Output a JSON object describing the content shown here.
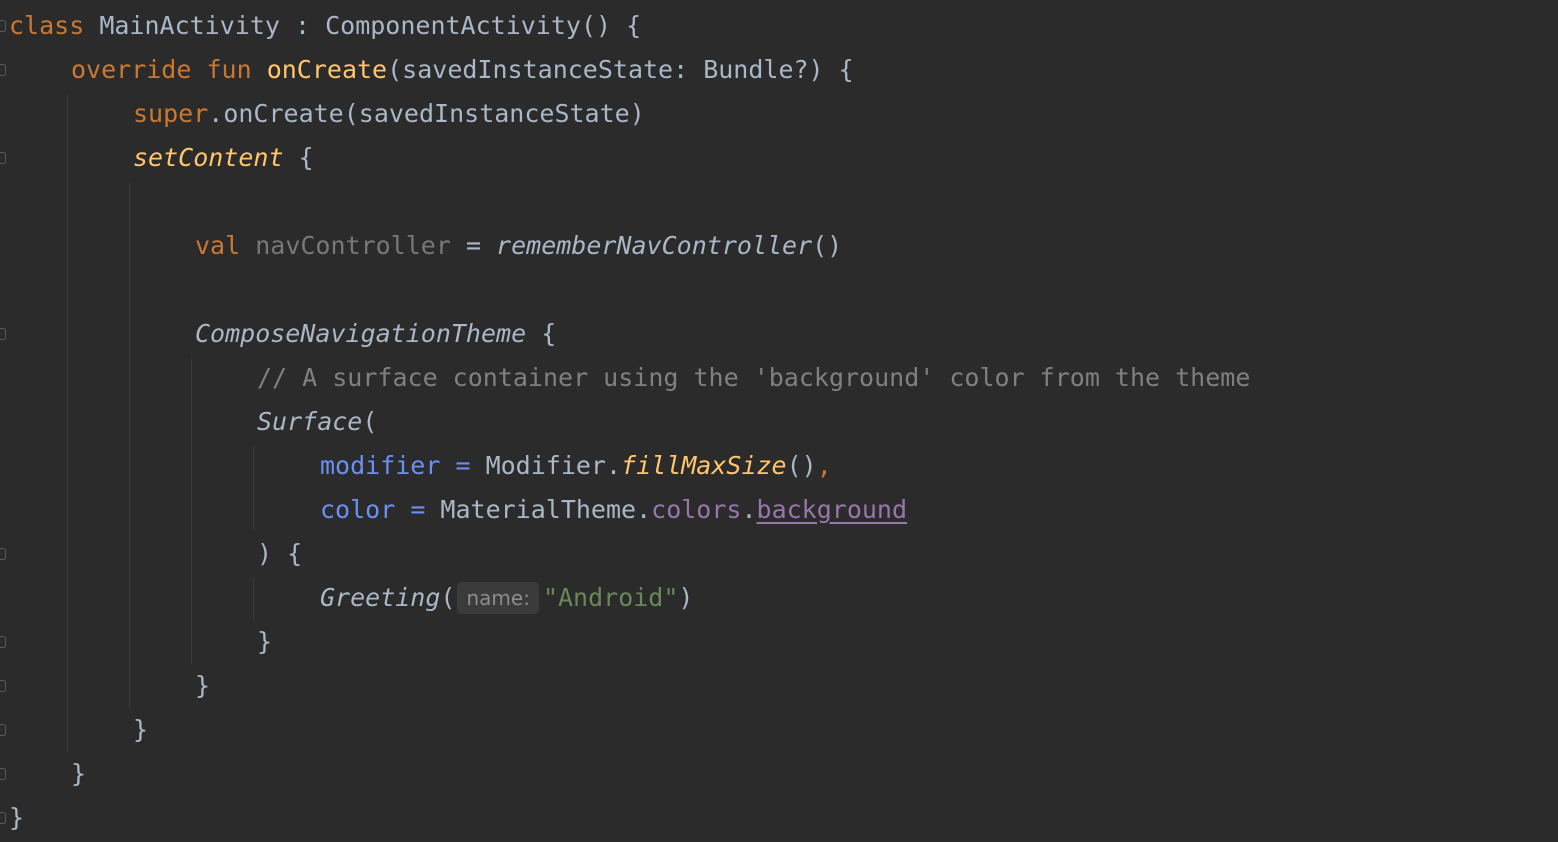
{
  "code": {
    "line1": {
      "kw_class": "class",
      "class_name": " MainActivity : ComponentActivity() {"
    },
    "line2": {
      "kw_override": "override",
      "kw_fun": "fun",
      "fn_name": "onCreate",
      "signature": "(savedInstanceState: Bundle?) {"
    },
    "line3": {
      "kw_super": "super",
      "call": ".onCreate(savedInstanceState)"
    },
    "line4": {
      "fn": "setContent",
      "brace": " {"
    },
    "line6": {
      "kw_val": "val",
      "var_name": "navController",
      "assign": " = ",
      "fn": "rememberNavController",
      "parens": "()"
    },
    "line8": {
      "fn": "ComposeNavigationTheme",
      "brace": " {"
    },
    "line9": {
      "comment": "// A surface container using the 'background' color from the theme"
    },
    "line10": {
      "fn": "Surface",
      "paren": "("
    },
    "line11": {
      "param": "modifier",
      "eq": " = ",
      "obj": "Modifier.",
      "ext": "fillMaxSize",
      "parens": "()",
      "comma": ","
    },
    "line12": {
      "param": "color",
      "eq": " = ",
      "obj": "MaterialTheme.",
      "prop": "colors",
      "dot": ".",
      "prop_link": "background"
    },
    "line13": {
      "text": ") {"
    },
    "line14": {
      "fn": "Greeting",
      "paren": "(",
      "hint": "name:",
      "str": "\"Android\"",
      "close": ")"
    },
    "line15": {
      "text": "}"
    },
    "line16": {
      "text": "}"
    },
    "line17": {
      "text": "}"
    },
    "line18": {
      "text": "}"
    },
    "line19": {
      "text": "}"
    }
  },
  "colors": {
    "background": "#2b2b2b",
    "keyword": "#cc7832",
    "function": "#ffc66d",
    "default": "#a9b7c6",
    "comment": "#808080",
    "parameter": "#6b8ff5",
    "property": "#9876aa",
    "string": "#6a8759"
  }
}
